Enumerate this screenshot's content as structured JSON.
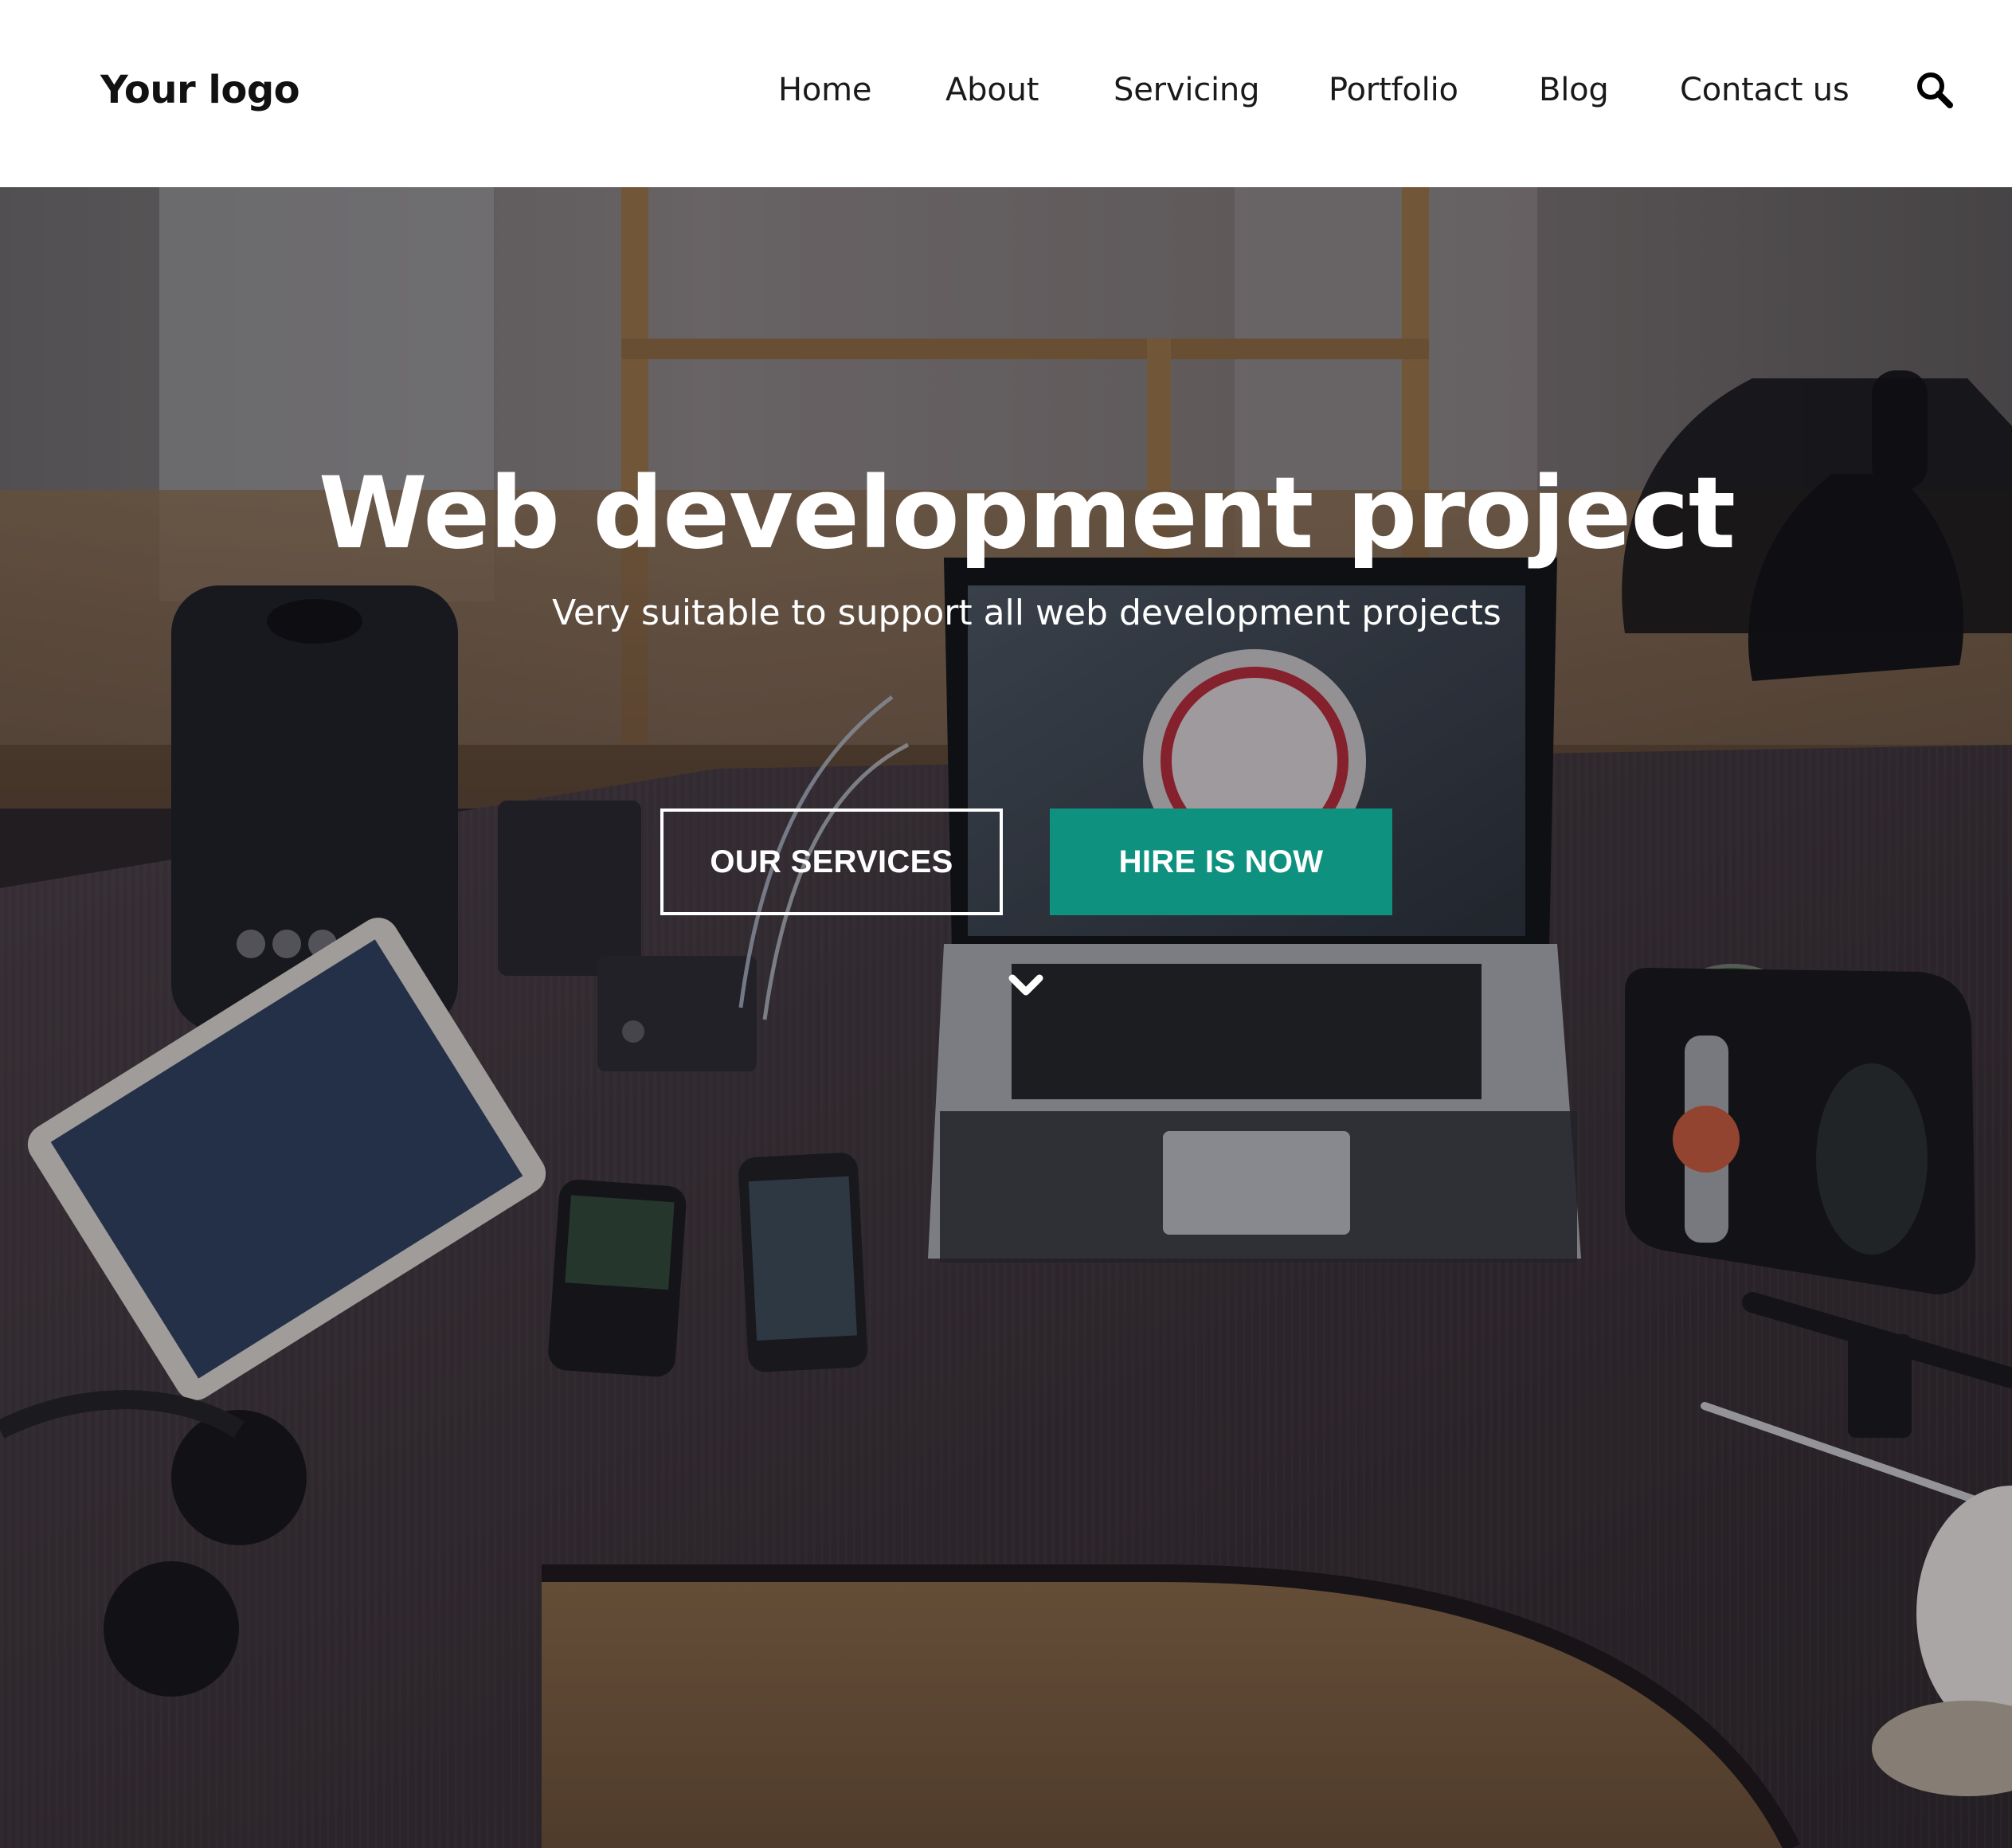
{
  "header": {
    "logo": "Your logo",
    "nav": {
      "home": "Home",
      "about": "About",
      "servicing": "Servicing",
      "portfolio": "Portfolio",
      "blog": "Blog",
      "contact": "Contact us"
    },
    "search_icon": "search-icon"
  },
  "hero": {
    "title": "Web development project",
    "subtitle": "Very suitable to support all web development projects",
    "buttons": {
      "services": "OUR SERVICES",
      "hire": "HIRE IS NOW"
    },
    "scroll_icon": "chevron-down-icon",
    "background_image": "desk-workspace-photo"
  },
  "colors": {
    "accent": "#0f9180",
    "header_bg": "#ffffff",
    "text_dark": "#1a1a1a",
    "hero_text": "#ffffff"
  }
}
